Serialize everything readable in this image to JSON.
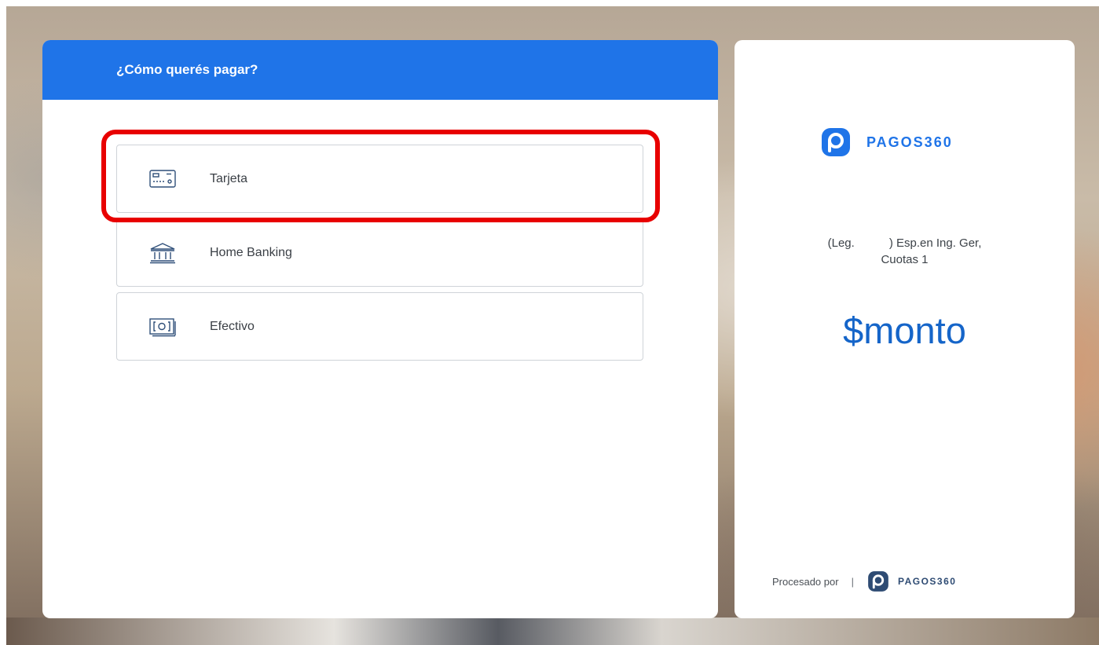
{
  "header": {
    "title": "¿Cómo querés pagar?"
  },
  "payment_options": [
    {
      "label": "Tarjeta",
      "icon": "credit-card-icon"
    },
    {
      "label": "Home Banking",
      "icon": "bank-icon"
    },
    {
      "label": "Efectivo",
      "icon": "cash-icon"
    }
  ],
  "summary": {
    "brand": "PAGOS360",
    "description_prefix": "(Leg.",
    "description_suffix": ") Esp.en Ing. Ger,",
    "description_line2": "Cuotas 1",
    "amount": "$monto"
  },
  "footer": {
    "processed_by": "Procesado por",
    "separator": "|",
    "brand": "PAGOS360"
  },
  "colors": {
    "header_blue": "#1f74e8",
    "brand_blue": "#1f74e8",
    "amount_blue": "#1565c9",
    "highlight_red": "#e80000"
  }
}
